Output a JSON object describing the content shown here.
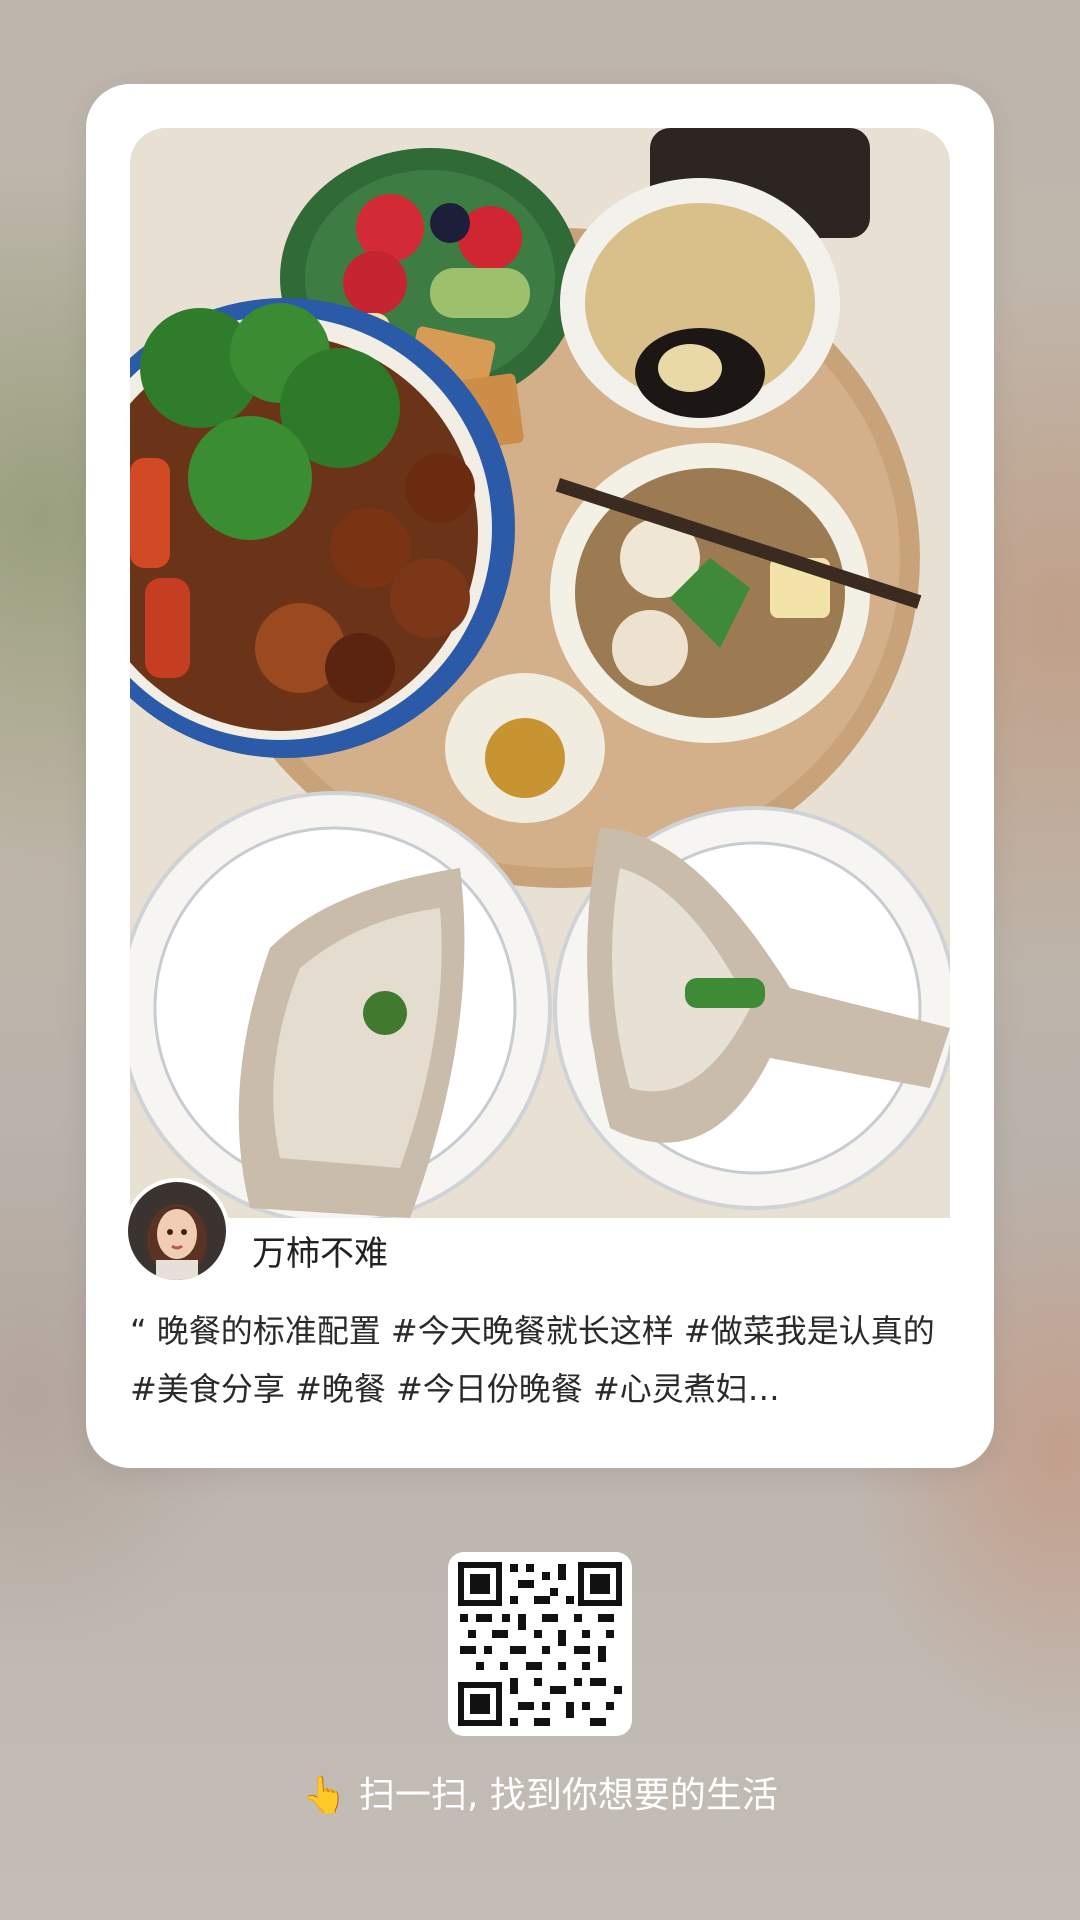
{
  "post": {
    "author": "万柿不难",
    "description": "“ 晚餐的标准配置 #今天晚餐就长这样 #做菜我是认真的 #美食分享 #晚餐 #今日份晚餐 #心灵煮妇…"
  },
  "footer": {
    "scan_text": "扫一扫, 找到你想要的生活",
    "hand_emoji": "👆"
  },
  "colors": {
    "card": "#ffffff",
    "scan_text": "#ffffff"
  }
}
